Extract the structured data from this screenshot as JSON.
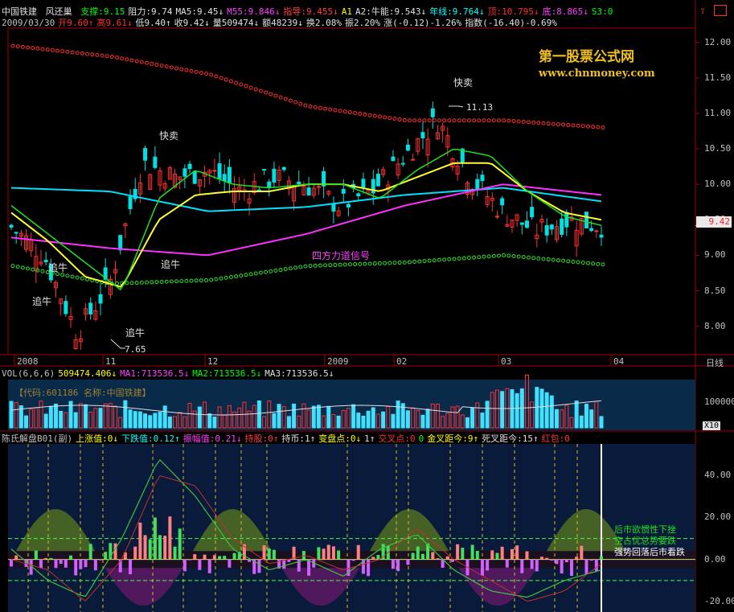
{
  "header": {
    "stock": "中国铁建",
    "formula": "风还巢",
    "items": [
      {
        "t": "支撑:9.15",
        "c": "#00ff00"
      },
      {
        "t": "阻力:9.74",
        "c": "#e0e0e0"
      },
      {
        "t": "MA5:9.45↓",
        "c": "#e0e0e0"
      },
      {
        "t": "M55:9.846↓",
        "c": "#ff40ff"
      },
      {
        "t": "指导:9.455↓",
        "c": "#ff4040"
      },
      {
        "t": "A1",
        "c": "#ffff00"
      },
      {
        "t": "A2:牛能:9.543↓",
        "c": "#e0e0e0"
      },
      {
        "t": "年线:9.764↓",
        "c": "#00ffff"
      },
      {
        "t": "顶:10.795↓",
        "c": "#ff3030"
      },
      {
        "t": "底:8.865↓",
        "c": "#ff40ff"
      },
      {
        "t": "S3:0",
        "c": "#00ff00"
      }
    ],
    "row2": [
      {
        "t": "2009/03/30",
        "c": "#c0c0c0"
      },
      {
        "t": "开9.60↑",
        "c": "#ff3030"
      },
      {
        "t": "高9.61↓",
        "c": "#ff3030"
      },
      {
        "t": "低9.40↑",
        "c": "#e0e0e0"
      },
      {
        "t": "收9.42↓",
        "c": "#e0e0e0"
      },
      {
        "t": "量509474↓",
        "c": "#e0e0e0"
      },
      {
        "t": "额48239↓",
        "c": "#e0e0e0"
      },
      {
        "t": "换2.08%",
        "c": "#e0e0e0"
      },
      {
        "t": "振2.20%",
        "c": "#e0e0e0"
      },
      {
        "t": "涨(-0.12)-1.26%",
        "c": "#e0e0e0"
      },
      {
        "t": "指数(-16.40)-0.69%",
        "c": "#e0e0e0"
      }
    ]
  },
  "watermark": {
    "line1": "第一股票公式网",
    "line2": "www.chnmoney.com"
  },
  "price_label": "9.42",
  "annotations": {
    "sell1": "快卖",
    "sell2": "快卖",
    "buy1": "追牛",
    "buy2": "追牛",
    "buy3": "追牛",
    "buy4": "追牛",
    "signal": "四方力道信号",
    "low": "7.65",
    "high": "11.13"
  },
  "x_axis": {
    "labels": [
      "2008",
      "11",
      "12",
      "2009",
      "02",
      "03",
      "04"
    ],
    "period": "日线"
  },
  "vol_panel": {
    "header": [
      {
        "t": "VOL(6,6,6)",
        "c": "#c0c0c0"
      },
      {
        "t": "509474.406↓",
        "c": "#ffff00"
      },
      {
        "t": "MA1:713536.5↓",
        "c": "#ff40ff"
      },
      {
        "t": "MA2:713536.5↓",
        "c": "#00ff00"
      },
      {
        "t": "MA3:713536.5↓",
        "c": "#e0e0e0"
      }
    ],
    "info": "【代码:601186  名称:中国铁建】",
    "scale": "X10",
    "ytick": "100000"
  },
  "osc_panel": {
    "header": [
      {
        "t": "陈氏解盘B01(副)",
        "c": "#c0c0c0"
      },
      {
        "t": "上涨值:0↓",
        "c": "#ffff00"
      },
      {
        "t": "下跌值:0.12↑",
        "c": "#00ffff"
      },
      {
        "t": "振幅值:0.21↓",
        "c": "#ff40ff"
      },
      {
        "t": "持股:0↑",
        "c": "#ff4040"
      },
      {
        "t": "持币:1↑",
        "c": "#e0e0e0"
      },
      {
        "t": "变盘点:0↓",
        "c": "#ffff00"
      },
      {
        "t": "1↑",
        "c": "#e0e0e0"
      },
      {
        "t": "交叉点:0",
        "c": "#ff3030"
      },
      {
        "t": "0",
        "c": "#00ff00"
      },
      {
        "t": "金叉距今:9↑",
        "c": "#ffff00"
      },
      {
        "t": "死叉距今:15↑",
        "c": "#e0e0e0"
      },
      {
        "t": "红包:0",
        "c": "#ff3030"
      }
    ],
    "signals": [
      "后市欲惯性下挫",
      "空占优总势要跌",
      "强势回落后市看跌"
    ],
    "yticks": [
      "40.00",
      "20.00",
      "0.00",
      "-20.00"
    ]
  },
  "chart_data": [
    {
      "type": "line",
      "title": "中国铁建 日线",
      "ylim": [
        7.6,
        12.2
      ],
      "yticks": [
        8.0,
        8.5,
        9.0,
        9.5,
        10.0,
        10.5,
        11.0,
        11.5,
        12.0
      ],
      "x": [
        "2008-10",
        "2008-11",
        "2008-12",
        "2009-01",
        "2009-02",
        "2009-03",
        "2009-04"
      ],
      "series": [
        {
          "name": "年线",
          "color": "#00e0ff",
          "values": [
            9.95,
            9.9,
            9.62,
            9.68,
            9.85,
            9.95,
            9.76
          ]
        },
        {
          "name": "M55",
          "color": "#ff30ff",
          "values": [
            9.25,
            9.1,
            9.0,
            9.3,
            9.7,
            10.0,
            9.85
          ]
        },
        {
          "name": "顶",
          "color": "#ff3030",
          "values": [
            11.95,
            11.8,
            11.55,
            11.1,
            10.9,
            10.9,
            10.8
          ]
        },
        {
          "name": "底",
          "color": "#30e030",
          "values": [
            8.85,
            8.6,
            8.65,
            8.85,
            8.9,
            9.0,
            8.87
          ]
        }
      ],
      "close": 9.42,
      "low": 7.65,
      "high": 11.13
    },
    {
      "type": "bar",
      "title": "VOL(6,6,6)",
      "values_last": 509474.406
    },
    {
      "type": "area",
      "title": "陈氏解盘B01(副)",
      "ylim": [
        -25,
        55
      ]
    }
  ]
}
